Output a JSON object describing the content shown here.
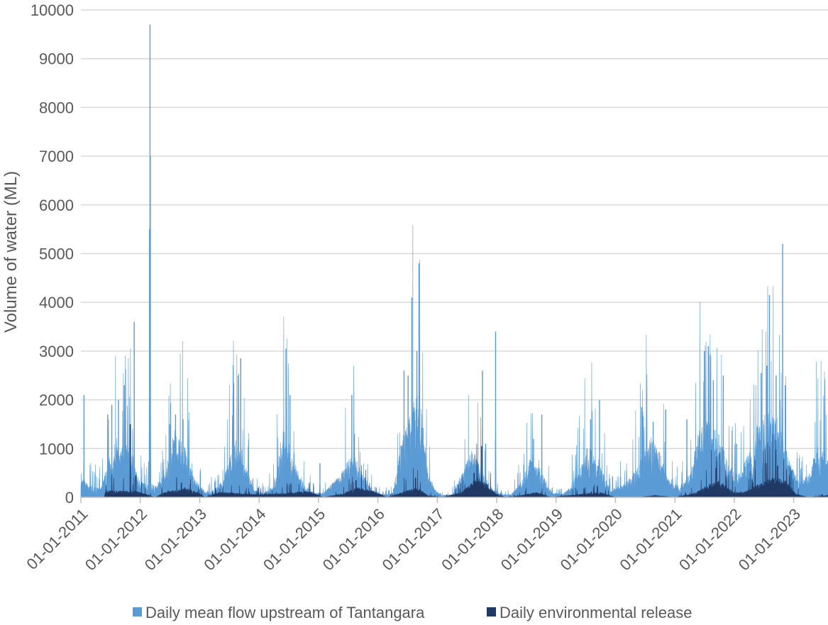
{
  "chart_data": {
    "type": "area",
    "title": "",
    "xlabel": "",
    "ylabel": "Volume of water (ML)",
    "ylim": [
      0,
      10000
    ],
    "xlim": [
      "2011-01-01",
      "2023-07-31"
    ],
    "yticks": [
      0,
      1000,
      2000,
      3000,
      4000,
      5000,
      6000,
      7000,
      8000,
      9000,
      10000
    ],
    "xtick_labels": [
      "01-01-2011",
      "01-01-2012",
      "01-01-2013",
      "01-01-2014",
      "01-01-2015",
      "01-01-2016",
      "01-01-2017",
      "01-01-2018",
      "01-01-2019",
      "01-01-2020",
      "01-01-2021",
      "01-01-2022",
      "01-01-2023"
    ],
    "grid": true,
    "legend": "bottom",
    "colors": {
      "flow": "#5b9bd5",
      "release": "#203864",
      "grid": "#d9d9d9",
      "axis": "#bfbfbf"
    },
    "series": [
      {
        "name": "Daily mean flow upstream of Tantangara",
        "key": "flow",
        "baseline": [
          [
            "2011-01-01",
            250
          ],
          [
            "2011-03-01",
            150
          ],
          [
            "2011-05-01",
            120
          ],
          [
            "2011-07-01",
            550
          ],
          [
            "2011-09-01",
            700
          ],
          [
            "2011-11-01",
            650
          ],
          [
            "2012-01-01",
            200
          ],
          [
            "2012-04-01",
            150
          ],
          [
            "2012-06-01",
            300
          ],
          [
            "2012-08-01",
            900
          ],
          [
            "2012-10-01",
            650
          ],
          [
            "2012-12-01",
            250
          ],
          [
            "2013-02-01",
            80
          ],
          [
            "2013-04-01",
            100
          ],
          [
            "2013-06-01",
            250
          ],
          [
            "2013-08-01",
            800
          ],
          [
            "2013-10-01",
            450
          ],
          [
            "2013-12-01",
            100
          ],
          [
            "2014-02-01",
            60
          ],
          [
            "2014-04-01",
            150
          ],
          [
            "2014-06-01",
            900
          ],
          [
            "2014-08-01",
            500
          ],
          [
            "2014-10-01",
            180
          ],
          [
            "2014-12-01",
            60
          ],
          [
            "2015-02-01",
            60
          ],
          [
            "2015-04-01",
            200
          ],
          [
            "2015-06-01",
            350
          ],
          [
            "2015-08-01",
            600
          ],
          [
            "2015-10-01",
            300
          ],
          [
            "2015-12-01",
            100
          ],
          [
            "2016-02-01",
            40
          ],
          [
            "2016-04-01",
            50
          ],
          [
            "2016-06-01",
            800
          ],
          [
            "2016-08-01",
            1200
          ],
          [
            "2016-09-15",
            1400
          ],
          [
            "2016-11-01",
            400
          ],
          [
            "2016-12-15",
            100
          ],
          [
            "2017-02-01",
            30
          ],
          [
            "2017-04-01",
            40
          ],
          [
            "2017-06-01",
            300
          ],
          [
            "2017-08-01",
            650
          ],
          [
            "2017-10-01",
            350
          ],
          [
            "2017-12-01",
            120
          ],
          [
            "2018-02-01",
            40
          ],
          [
            "2018-04-01",
            40
          ],
          [
            "2018-06-01",
            200
          ],
          [
            "2018-08-01",
            550
          ],
          [
            "2018-10-01",
            350
          ],
          [
            "2018-12-01",
            80
          ],
          [
            "2019-02-01",
            40
          ],
          [
            "2019-04-01",
            150
          ],
          [
            "2019-06-01",
            400
          ],
          [
            "2019-08-01",
            650
          ],
          [
            "2019-10-01",
            400
          ],
          [
            "2019-12-01",
            100
          ],
          [
            "2020-02-01",
            150
          ],
          [
            "2020-04-01",
            250
          ],
          [
            "2020-06-01",
            500
          ],
          [
            "2020-08-01",
            800
          ],
          [
            "2020-10-01",
            600
          ],
          [
            "2020-12-01",
            200
          ],
          [
            "2021-02-01",
            150
          ],
          [
            "2021-04-01",
            300
          ],
          [
            "2021-06-01",
            900
          ],
          [
            "2021-08-01",
            1000
          ],
          [
            "2021-10-01",
            800
          ],
          [
            "2021-12-01",
            400
          ],
          [
            "2022-02-01",
            300
          ],
          [
            "2022-04-01",
            600
          ],
          [
            "2022-06-01",
            1000
          ],
          [
            "2022-08-01",
            1100
          ],
          [
            "2022-10-01",
            1000
          ],
          [
            "2022-12-01",
            500
          ],
          [
            "2023-02-01",
            200
          ],
          [
            "2023-04-01",
            300
          ],
          [
            "2023-06-01",
            700
          ],
          [
            "2023-07-31",
            500
          ]
        ],
        "peaks": [
          [
            "2011-01-20",
            2100
          ],
          [
            "2011-06-15",
            1700
          ],
          [
            "2011-07-10",
            1900
          ],
          [
            "2011-08-20",
            2000
          ],
          [
            "2011-09-25",
            2300
          ],
          [
            "2011-11-25",
            3600
          ],
          [
            "2012-03-01",
            9700
          ],
          [
            "2012-03-03",
            7000
          ],
          [
            "2012-02-27",
            5500
          ],
          [
            "2012-07-01",
            1500
          ],
          [
            "2012-08-05",
            1700
          ],
          [
            "2012-09-20",
            1600
          ],
          [
            "2013-07-25",
            2100
          ],
          [
            "2013-08-25",
            2500
          ],
          [
            "2013-09-10",
            2850
          ],
          [
            "2014-06-15",
            3050
          ],
          [
            "2014-07-10",
            2100
          ],
          [
            "2015-01-10",
            700
          ],
          [
            "2015-07-25",
            2100
          ],
          [
            "2015-08-10",
            1300
          ],
          [
            "2016-06-10",
            2600
          ],
          [
            "2016-07-05",
            2500
          ],
          [
            "2016-07-28",
            4100
          ],
          [
            "2016-08-28",
            3000
          ],
          [
            "2016-09-10",
            4800
          ],
          [
            "2017-10-05",
            2600
          ],
          [
            "2017-10-25",
            1100
          ],
          [
            "2017-12-25",
            3400
          ],
          [
            "2018-08-15",
            1200
          ],
          [
            "2018-10-05",
            1700
          ],
          [
            "2019-07-10",
            1000
          ],
          [
            "2019-08-01",
            1600
          ],
          [
            "2019-09-25",
            2000
          ],
          [
            "2020-06-10",
            1850
          ],
          [
            "2020-08-20",
            1550
          ],
          [
            "2020-11-05",
            1800
          ],
          [
            "2021-03-15",
            1600
          ],
          [
            "2021-07-01",
            3000
          ],
          [
            "2021-07-25",
            3100
          ],
          [
            "2021-08-25",
            2400
          ],
          [
            "2021-10-25",
            2500
          ],
          [
            "2022-01-15",
            1100
          ],
          [
            "2022-06-15",
            2550
          ],
          [
            "2022-07-20",
            2700
          ],
          [
            "2022-08-05",
            4150
          ],
          [
            "2022-09-15",
            2500
          ],
          [
            "2022-10-25",
            5200
          ],
          [
            "2022-11-10",
            2300
          ],
          [
            "2023-07-10",
            1750
          ]
        ]
      },
      {
        "name": "Daily environmental release",
        "key": "release",
        "baseline": [
          [
            "2011-01-01",
            0
          ],
          [
            "2011-05-25",
            0
          ],
          [
            "2011-06-01",
            100
          ],
          [
            "2011-11-15",
            100
          ],
          [
            "2011-12-31",
            80
          ],
          [
            "2012-04-01",
            0
          ],
          [
            "2012-06-01",
            80
          ],
          [
            "2012-10-01",
            150
          ],
          [
            "2012-12-15",
            80
          ],
          [
            "2013-02-01",
            0
          ],
          [
            "2013-05-01",
            80
          ],
          [
            "2013-09-15",
            60
          ],
          [
            "2013-12-01",
            50
          ],
          [
            "2014-06-01",
            60
          ],
          [
            "2014-11-01",
            100
          ],
          [
            "2015-02-01",
            0
          ],
          [
            "2015-06-01",
            60
          ],
          [
            "2015-09-01",
            150
          ],
          [
            "2015-12-01",
            100
          ],
          [
            "2016-03-01",
            0
          ],
          [
            "2016-06-01",
            80
          ],
          [
            "2016-09-01",
            150
          ],
          [
            "2016-11-01",
            30
          ],
          [
            "2017-02-01",
            0
          ],
          [
            "2017-06-01",
            80
          ],
          [
            "2017-09-01",
            300
          ],
          [
            "2017-11-01",
            200
          ],
          [
            "2017-12-31",
            50
          ],
          [
            "2018-03-01",
            0
          ],
          [
            "2018-06-01",
            30
          ],
          [
            "2018-09-01",
            80
          ],
          [
            "2018-12-01",
            0
          ],
          [
            "2019-06-01",
            50
          ],
          [
            "2019-10-01",
            80
          ],
          [
            "2019-12-31",
            0
          ],
          [
            "2020-06-01",
            0
          ],
          [
            "2020-09-01",
            30
          ],
          [
            "2020-12-31",
            0
          ],
          [
            "2021-05-01",
            60
          ],
          [
            "2021-08-01",
            200
          ],
          [
            "2021-10-01",
            250
          ],
          [
            "2021-12-31",
            80
          ],
          [
            "2022-03-01",
            80
          ],
          [
            "2022-06-01",
            200
          ],
          [
            "2022-09-01",
            300
          ],
          [
            "2022-11-15",
            250
          ],
          [
            "2023-01-15",
            50
          ],
          [
            "2023-04-01",
            0
          ],
          [
            "2023-07-31",
            30
          ]
        ],
        "peaks": [
          [
            "2011-11-01",
            1500
          ],
          [
            "2011-12-05",
            450
          ],
          [
            "2017-10-01",
            1050
          ],
          [
            "2017-08-15",
            500
          ],
          [
            "2021-09-10",
            600
          ],
          [
            "2022-07-10",
            700
          ],
          [
            "2022-09-25",
            650
          ],
          [
            "2016-08-20",
            400
          ],
          [
            "2012-09-10",
            300
          ],
          [
            "2015-08-20",
            350
          ]
        ]
      }
    ]
  },
  "legend": {
    "flow_label": "Daily mean flow upstream of Tantangara",
    "release_label": "Daily environmental release"
  }
}
